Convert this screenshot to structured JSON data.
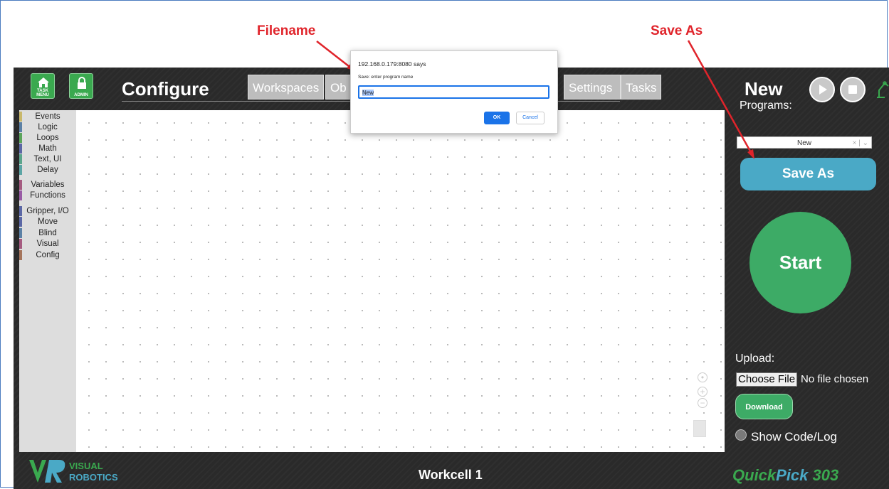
{
  "annotations": {
    "filename": "Filename",
    "save_as": "Save As"
  },
  "header": {
    "home_label": "TASK MENU",
    "admin_label": "ADMIN",
    "title": "Configure",
    "tabs": [
      "Workspaces",
      "Ob",
      "Settings",
      "Tasks"
    ],
    "program_name": "New"
  },
  "categories": [
    {
      "label": "Events",
      "color": "#c9b86a"
    },
    {
      "label": "Logic",
      "color": "#5b80a5"
    },
    {
      "label": "Loops",
      "color": "#5ba55b"
    },
    {
      "label": "Math",
      "color": "#5b67a5"
    },
    {
      "label": "Text, UI",
      "color": "#5ba58c"
    },
    {
      "label": "Delay",
      "color": "#5ba5a5"
    },
    {
      "label": "Variables",
      "color": "#a55b80"
    },
    {
      "label": "Functions",
      "color": "#995ba5"
    },
    {
      "label": "Gripper, I/O",
      "color": "#5b67a5"
    },
    {
      "label": "Move",
      "color": "#5b67a5"
    },
    {
      "label": "Blind",
      "color": "#5b80a5"
    },
    {
      "label": "Visual",
      "color": "#a55b80"
    },
    {
      "label": "Config",
      "color": "#a5745b"
    }
  ],
  "right_panel": {
    "programs_label": "Programs:",
    "programs_selected": "New",
    "save_as_label": "Save As",
    "start_label": "Start",
    "upload_label": "Upload:",
    "choose_file_label": "Choose File",
    "no_file_text": "No file chosen",
    "download_label": "Download",
    "show_code_label": "Show Code/Log"
  },
  "footer": {
    "logo_text_1": "VISUAL",
    "logo_text_2": "ROBOTICS",
    "workcell": "Workcell 1",
    "product_part1": "Quick",
    "product_part2": "Pick",
    "product_part3": " 303"
  },
  "dialog": {
    "title": "192.168.0.179:8080 says",
    "message": "Save: enter program name",
    "input_value": "New",
    "ok_label": "OK",
    "cancel_label": "Cancel"
  }
}
